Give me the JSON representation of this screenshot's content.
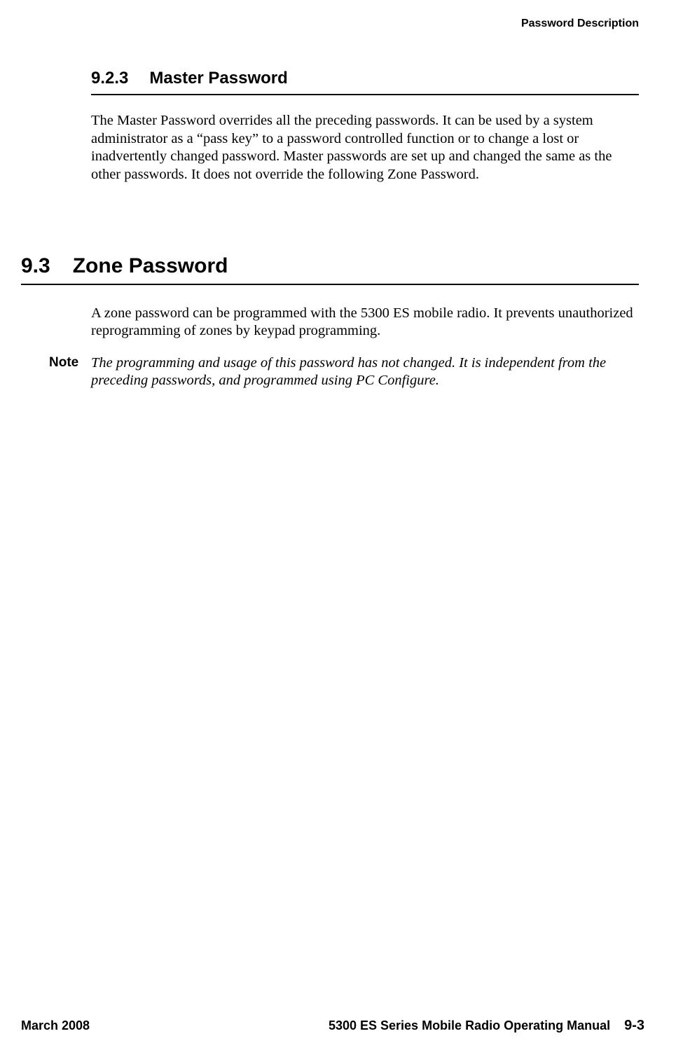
{
  "header": {
    "running_title": "Password Description"
  },
  "section_923": {
    "number": "9.2.3",
    "title": "Master Password",
    "body": "The Master Password overrides all the preceding passwords. It can be used by a system administrator as a “pass key” to a password controlled function or to change a lost or inadvertently changed password. Master passwords are set up and changed the same as the other passwords. It does not override the following Zone Password."
  },
  "section_93": {
    "number": "9.3",
    "title": "Zone Password",
    "body": "A zone password can be programmed with the 5300 ES mobile radio. It prevents unauthorized reprogramming of zones by keypad programming.",
    "note_label": "Note",
    "note_text": "The programming and usage of this password has not changed. It is independent from the preceding passwords, and programmed using PC Configure."
  },
  "footer": {
    "date": "March 2008",
    "manual": "5300 ES Series Mobile Radio Operating Manual",
    "page": "9-3"
  }
}
